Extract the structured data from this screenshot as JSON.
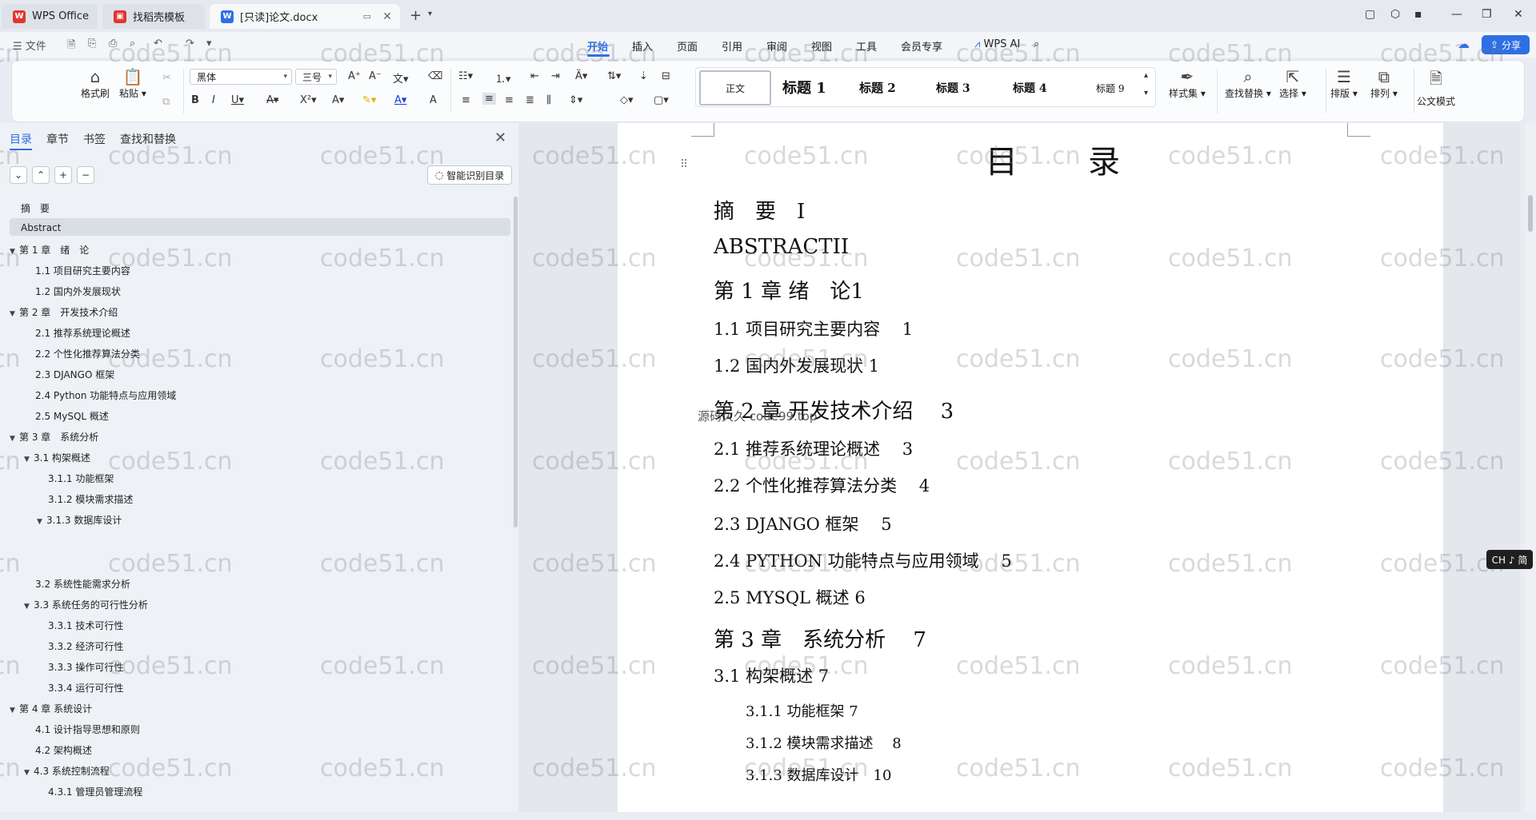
{
  "tabs": {
    "wps": "WPS Office",
    "template": "找稻壳模板",
    "doc": "[只读]论文.docx"
  },
  "menu": {
    "file": "文件",
    "items": [
      "开始",
      "插入",
      "页面",
      "引用",
      "审阅",
      "视图",
      "工具",
      "会员专享"
    ],
    "wps_ai": "WPS AI",
    "share": "分享"
  },
  "ribbon": {
    "format_painter": "格式刷",
    "paste": "粘贴",
    "font_name": "黑体",
    "font_size": "三号",
    "styles": [
      "正文",
      "标题 1",
      "标题 2",
      "标题 3",
      "标题 4",
      "标题 9"
    ],
    "style_set": "样式集",
    "find_replace": "查找替换",
    "select": "选择",
    "layout": "排版",
    "arrange": "排列",
    "official_mode": "公文模式"
  },
  "panel": {
    "tabs": [
      "目录",
      "章节",
      "书签",
      "查找和替换"
    ],
    "smart_toc": "智能识别目录",
    "toc": [
      {
        "text": "摘　要",
        "level": 1,
        "arrow": false
      },
      {
        "text": "Abstract",
        "level": 1,
        "arrow": false
      },
      {
        "text": "第 1 章　绪　论",
        "level": 1,
        "arrow": true
      },
      {
        "text": "1.1 项目研究主要内容",
        "level": 2,
        "arrow": false
      },
      {
        "text": "1.2  国内外发展现状",
        "level": 2,
        "arrow": false
      },
      {
        "text": "第 2 章　开发技术介绍",
        "level": 1,
        "arrow": true
      },
      {
        "text": "2.1  推荐系统理论概述",
        "level": 2,
        "arrow": false
      },
      {
        "text": "2.2  个性化推荐算法分类",
        "level": 2,
        "arrow": false
      },
      {
        "text": "2.3 DJANGO 框架",
        "level": 2,
        "arrow": false
      },
      {
        "text": "2.4 Python  功能特点与应用领域",
        "level": 2,
        "arrow": false
      },
      {
        "text": "2.5 MySQL 概述",
        "level": 2,
        "arrow": false
      },
      {
        "text": "第 3 章　系统分析",
        "level": 1,
        "arrow": true
      },
      {
        "text": "3.1  构架概述",
        "level": 2,
        "arrow": true
      },
      {
        "text": "3.1.1  功能框架",
        "level": 3,
        "arrow": false
      },
      {
        "text": "3.1.2  模块需求描述",
        "level": 3,
        "arrow": false
      },
      {
        "text": "3.1.3  数据库设计",
        "level": 3,
        "arrow": true
      },
      {
        "text": "3.2 系统性能需求分析",
        "level": 2,
        "arrow": false
      },
      {
        "text": "3.3  系统任务的可行性分析",
        "level": 2,
        "arrow": true
      },
      {
        "text": "3.3.1 技术可行性",
        "level": 3,
        "arrow": false
      },
      {
        "text": "3.3.2 经济可行性",
        "level": 3,
        "arrow": false
      },
      {
        "text": "3.3.3 操作可行性",
        "level": 3,
        "arrow": false
      },
      {
        "text": "3.3.4  运行可行性",
        "level": 3,
        "arrow": false
      },
      {
        "text": "第 4 章  系统设计",
        "level": 1,
        "arrow": true
      },
      {
        "text": "4.1 设计指导思想和原则",
        "level": 2,
        "arrow": false
      },
      {
        "text": "4.2  架构概述",
        "level": 2,
        "arrow": false
      },
      {
        "text": "4.3  系统控制流程",
        "level": 2,
        "arrow": true
      },
      {
        "text": "4.3.1  管理员管理流程",
        "level": 3,
        "arrow": false
      }
    ]
  },
  "document": {
    "title": "目　录",
    "overlay": "源码久久 code99.top",
    "entries": [
      {
        "text": "摘　要　I",
        "level": 1
      },
      {
        "text": "ABSTRACTII",
        "level": 1
      },
      {
        "text": "第 1 章  绪　论1",
        "level": 1
      },
      {
        "text": "1.1 项目研究主要内容　 1",
        "level": 2
      },
      {
        "text": "1.2  国内外发展现状  1",
        "level": 2
      },
      {
        "text": "第 2 章  开发技术介绍　 3",
        "level": 1
      },
      {
        "text": "2.1  推荐系统理论概述　 3",
        "level": 2
      },
      {
        "text": "2.2  个性化推荐算法分类　  4",
        "level": 2
      },
      {
        "text": "2.3 DJANGO 框架　  5",
        "level": 2
      },
      {
        "text": "2.4 PYTHON  功能特点与应用领域　 5",
        "level": 2
      },
      {
        "text": "2.5 MYSQL  概述  6",
        "level": 2
      },
      {
        "text": "第 3 章　系统分析　 7",
        "level": 1
      },
      {
        "text": "3.1  构架概述  7",
        "level": 2
      },
      {
        "text": "3.1.1  功能框架  7",
        "level": 3
      },
      {
        "text": "3.1.2  模块需求描述　  8",
        "level": 3
      },
      {
        "text": "3.1.3  数据库设计　10",
        "level": 3
      }
    ]
  },
  "watermark": "code51.cn",
  "ime": "CH ♪ 简"
}
